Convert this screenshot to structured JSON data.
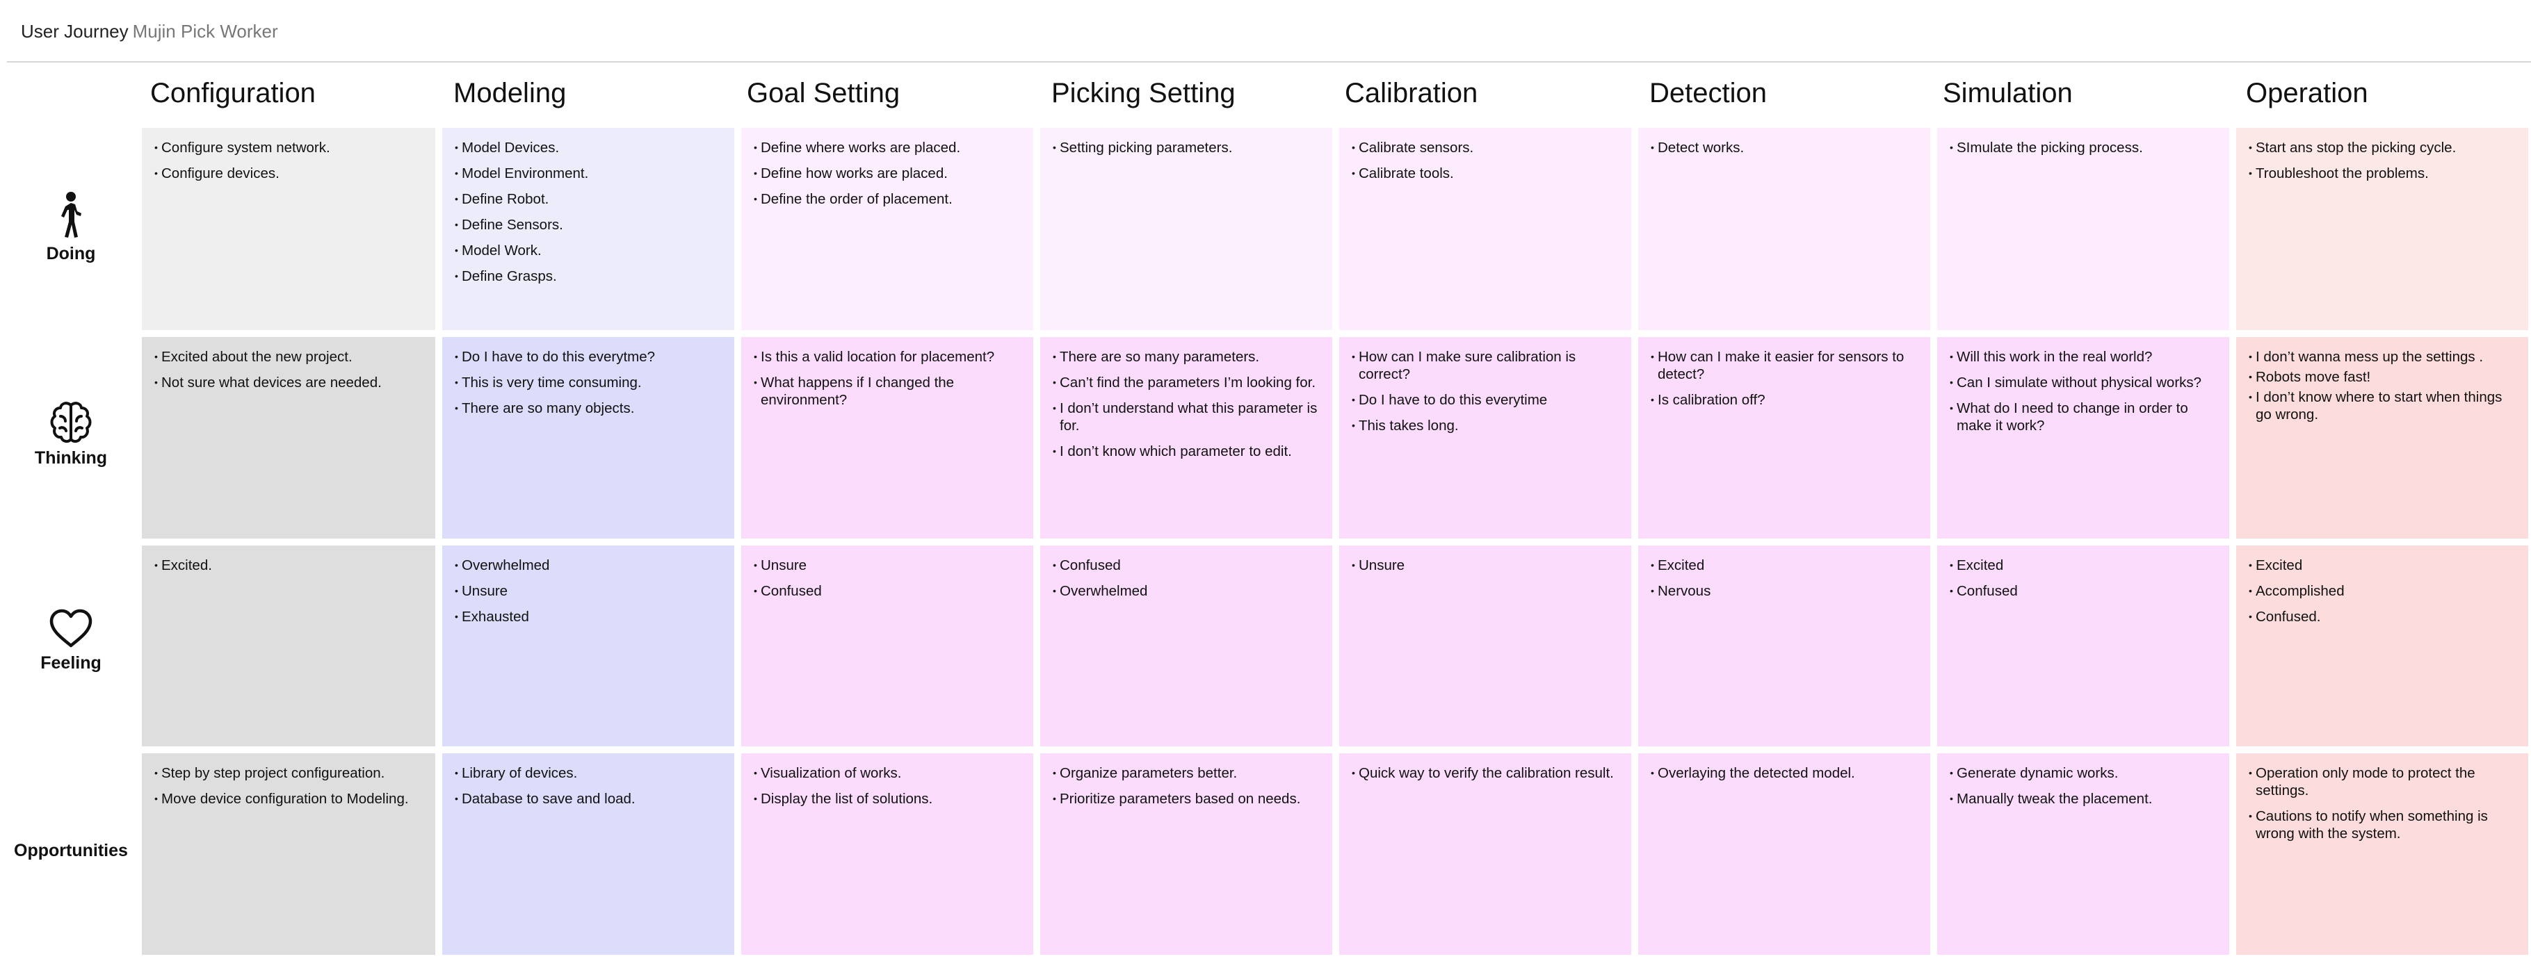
{
  "header": {
    "title": "User Journey",
    "subtitle": "Mujin Pick Worker"
  },
  "columns": [
    {
      "title": "Configuration",
      "color": "#efefef",
      "color_feel": "#dedede"
    },
    {
      "title": "Modeling",
      "color": "#ececfb",
      "color_feel": "#dcdcfb"
    },
    {
      "title": "Goal Setting",
      "color": "#fceefe",
      "color_feel": "#fcdcfc"
    },
    {
      "title": "Picking Setting",
      "color": "#fcf0fe",
      "color_feel": "#fcdcfc"
    },
    {
      "title": "Calibration",
      "color": "#fcecfd",
      "color_feel": "#fcdcfc"
    },
    {
      "title": "Detection",
      "color": "#fcecfd",
      "color_feel": "#fcdcfc"
    },
    {
      "title": "Simulation",
      "color": "#fcecfd",
      "color_feel": "#fcdcfc"
    },
    {
      "title": "Operation",
      "color": "#fde8e8",
      "color_feel": "#fcdcdc"
    }
  ],
  "rows": [
    {
      "label": "Doing",
      "icon": "person-walking-icon"
    },
    {
      "label": "Thinking",
      "icon": "brain-icon"
    },
    {
      "label": "Feeling",
      "icon": "heart-icon"
    },
    {
      "label": "Opportunities",
      "icon": ""
    }
  ],
  "cells": {
    "doing": [
      [
        "Configure system network.",
        "Configure devices."
      ],
      [
        "Model Devices.",
        "Model Environment.",
        "Define Robot.",
        "Define Sensors.",
        "Model Work.",
        "Define Grasps."
      ],
      [
        "Define where works are placed.",
        "Define how works are placed.",
        "Define the order of placement."
      ],
      [
        "Setting picking parameters."
      ],
      [
        "Calibrate sensors.",
        "Calibrate tools."
      ],
      [
        "Detect works."
      ],
      [
        "SImulate the picking process."
      ],
      [
        "Start ans stop the picking cycle.",
        "Troubleshoot the problems."
      ]
    ],
    "thinking": [
      [
        "Excited about the new project.",
        "Not sure what devices are needed."
      ],
      [
        "Do I have to do this everytme?",
        "This is very time consuming.",
        "There are so many objects."
      ],
      [
        "Is this a valid location for placement?",
        "What happens if I changed the environment?"
      ],
      [
        "There are so many parameters.",
        "Can’t find the parameters I’m looking for.",
        "I don’t understand what this parameter is for.",
        "I don’t  know which parameter to edit."
      ],
      [
        "How can I make sure calibration is correct?",
        "Do I have to do this everytime",
        "This takes long."
      ],
      [
        "How can I make it easier for sensors to detect?",
        "Is calibration off?"
      ],
      [
        "Will this work in the real world?",
        "Can I simulate without physical works?",
        "What do I need to change in order to make it work?"
      ],
      [
        "I don’t wanna mess up the settings .",
        "Robots move fast!",
        "I don’t know where to start when things go wrong."
      ]
    ],
    "feeling": [
      [
        "Excited."
      ],
      [
        "Overwhelmed",
        "Unsure",
        "Exhausted"
      ],
      [
        "Unsure",
        "Confused"
      ],
      [
        "Confused",
        "Overwhelmed"
      ],
      [
        "Unsure"
      ],
      [
        "Excited",
        "Nervous"
      ],
      [
        "Excited",
        "Confused"
      ],
      [
        "Excited",
        "Accomplished",
        "Confused."
      ]
    ],
    "opportunities": [
      [
        "Step by step project configureation.",
        "Move device configuration to Modeling."
      ],
      [
        "Library of devices.",
        "Database to save and load."
      ],
      [
        "Visualization of works.",
        "Display the list of solutions."
      ],
      [
        "Organize parameters better.",
        "Prioritize parameters based on needs."
      ],
      [
        "Quick way to verify the calibration result."
      ],
      [
        "Overlaying the detected model."
      ],
      [
        "Generate dynamic works.",
        "Manually tweak the placement."
      ],
      [
        "Operation only mode to protect the settings.",
        "Cautions to notify when something is wrong with the system."
      ]
    ]
  }
}
